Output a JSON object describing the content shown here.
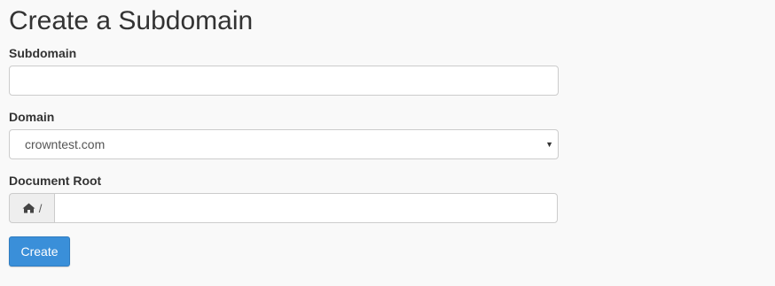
{
  "page": {
    "title": "Create a Subdomain"
  },
  "form": {
    "subdomain": {
      "label": "Subdomain",
      "value": "",
      "placeholder": ""
    },
    "domain": {
      "label": "Domain",
      "selected": "crowntest.com",
      "arrow_icon": "caret-down-icon"
    },
    "document_root": {
      "label": "Document Root",
      "prefix_icon": "home-icon",
      "prefix_text": "/",
      "value": "",
      "placeholder": ""
    },
    "submit": {
      "label": "Create"
    }
  },
  "colors": {
    "background": "#f9f9f9",
    "primary_button": "#3a8fd9",
    "input_border": "#cccccc",
    "addon_background": "#eeeeee"
  }
}
